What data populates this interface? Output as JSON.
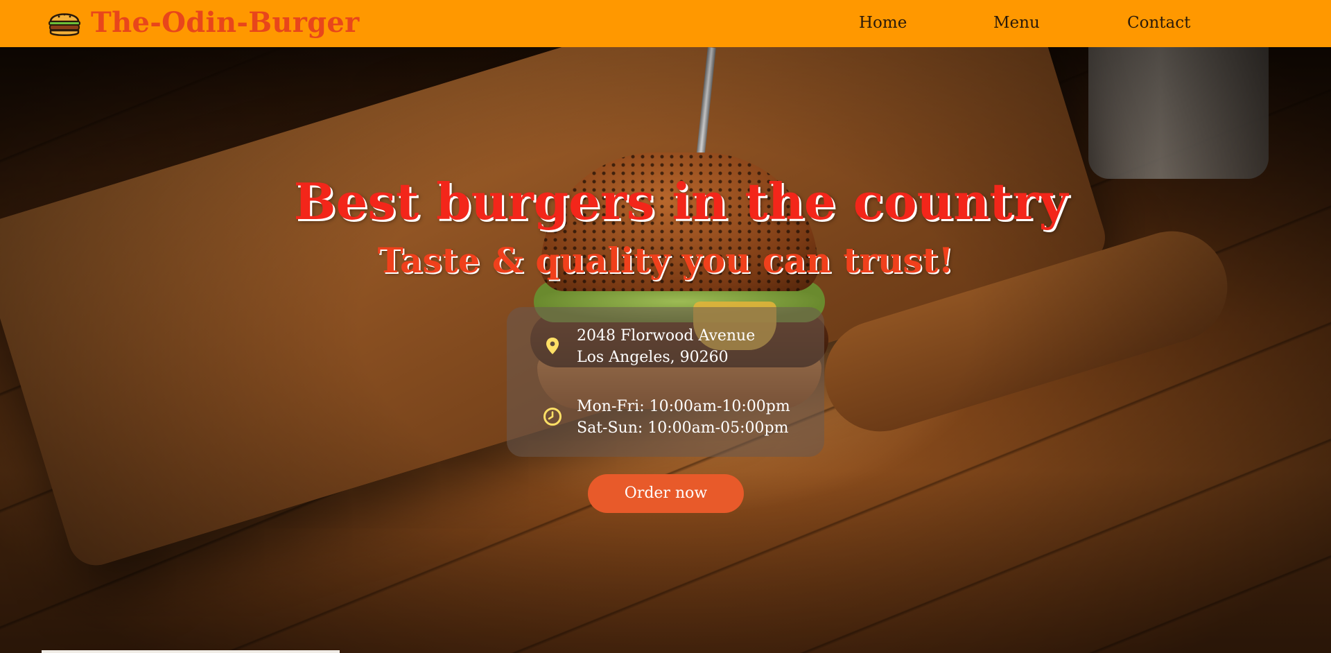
{
  "header": {
    "brand_name": "The-Odin-Burger",
    "brand_icon": "burger-icon",
    "nav": [
      {
        "label": "Home"
      },
      {
        "label": "Menu"
      },
      {
        "label": "Contact"
      }
    ]
  },
  "hero": {
    "headline": "Best burgers in the country",
    "subheadline": "Taste & quality you can trust!",
    "background": "burger-on-wooden-board-photo",
    "address": {
      "icon": "map-pin-icon",
      "line1": "2048 Florwood Avenue",
      "line2": "Los Angeles, 90260"
    },
    "hours": {
      "icon": "clock-icon",
      "line1": "Mon-Fri: 10:00am-10:00pm",
      "line2": "Sat-Sun: 10:00am-05:00pm"
    },
    "cta_label": "Order now"
  },
  "colors": {
    "header_bg": "#ff9800",
    "brand": "#e8461b",
    "headline": "#f3261a",
    "cta": "#e85a2a",
    "icon": "#ffe066"
  }
}
